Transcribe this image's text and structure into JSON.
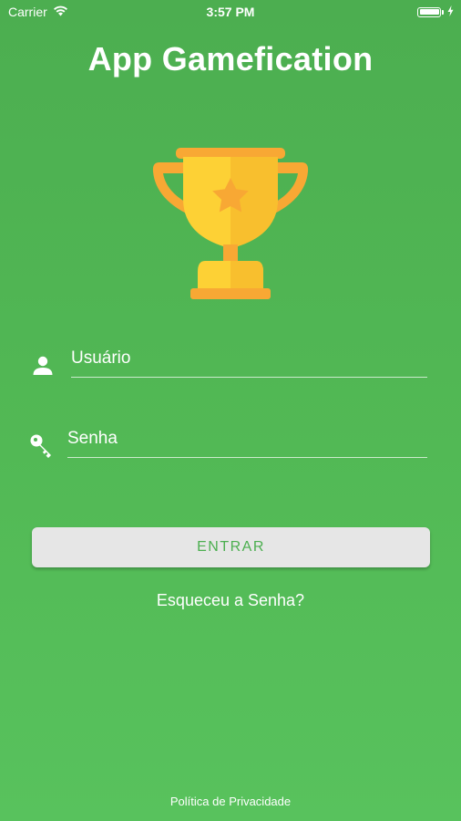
{
  "status_bar": {
    "carrier": "Carrier",
    "time": "3:57 PM",
    "wifi_icon": "wifi-icon",
    "battery_icon": "battery-icon",
    "charging_icon": "charging-bolt-icon"
  },
  "header": {
    "title": "App Gamefication"
  },
  "logo": {
    "icon": "trophy-icon",
    "colors": {
      "cup": "#fdd135",
      "handles": "#f8a834",
      "star": "#f8a834",
      "base": "#fdd135",
      "plate": "#f8a834"
    }
  },
  "login_form": {
    "username": {
      "icon": "user-icon",
      "placeholder": "Usuário",
      "value": ""
    },
    "password": {
      "icon": "key-icon",
      "placeholder": "Senha",
      "value": ""
    },
    "submit_label": "ENTRAR",
    "forgot_password_label": "Esqueceu a Senha?"
  },
  "footer": {
    "privacy_label": "Política de Privacidade"
  },
  "colors": {
    "background": "#50b553",
    "button_bg": "#e6e6e6",
    "button_text": "#4caf50",
    "text": "#ffffff"
  }
}
